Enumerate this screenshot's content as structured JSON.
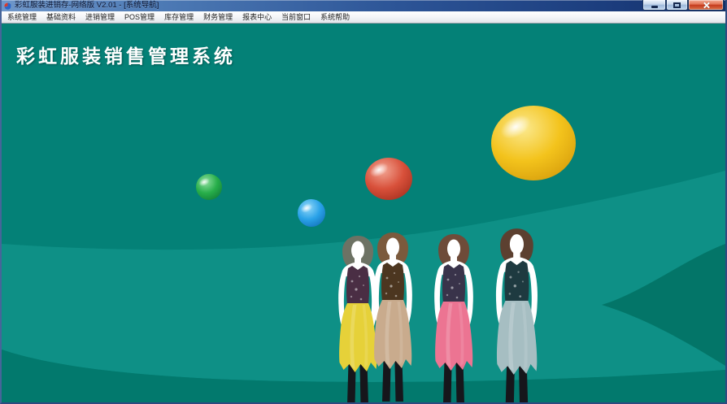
{
  "window": {
    "title": "彩虹服装进销存-网络版 V2.01 - [系统导航]"
  },
  "menubar": {
    "items": [
      {
        "label": "系统管理"
      },
      {
        "label": "基础资料"
      },
      {
        "label": "进销管理"
      },
      {
        "label": "POS管理"
      },
      {
        "label": "库存管理"
      },
      {
        "label": "财务管理"
      },
      {
        "label": "报表中心"
      },
      {
        "label": "当前窗口"
      },
      {
        "label": "系统帮助"
      }
    ]
  },
  "client": {
    "heading": "彩虹服装销售管理系统"
  },
  "colors": {
    "client_background": "#048177",
    "band_light": "#0e9086",
    "wedge_dark": "#037568",
    "bottom_dark": "#02796d",
    "titlebar_blue": "#2c5496",
    "menu_text": "#1f1f1f",
    "close_button_red": "#c43a1e",
    "heading_text": "#ffffff"
  },
  "balls": [
    {
      "name": "green-ball",
      "light": "#8fdfa0",
      "base": "#27ae4a",
      "dark": "#128038"
    },
    {
      "name": "blue-ball",
      "light": "#92d8f8",
      "base": "#2aa2e8",
      "dark": "#1374bd"
    },
    {
      "name": "red-ball",
      "light": "#f2a593",
      "base": "#d8503a",
      "dark": "#a83120"
    },
    {
      "name": "yellow-ball",
      "light": "#fbe98f",
      "base": "#f3c31c",
      "dark": "#d79e0c"
    }
  ],
  "figures": [
    {
      "name": "mannequin-yellow-dress",
      "hair": "#6d7264",
      "top_color": "#4a2e44",
      "skirt": "#e6d139",
      "skin": "#ffffff",
      "legs": "#16161b"
    },
    {
      "name": "mannequin-tan-dress",
      "hair": "#7b5a3d",
      "top_color": "#4c3620",
      "skirt": "#c9ab8d",
      "skin": "#ffffff",
      "legs": "#16161b"
    },
    {
      "name": "mannequin-pink-dress",
      "hair": "#6e4b39",
      "top_color": "#39334a",
      "skirt": "#ec7492",
      "skin": "#ffffff",
      "legs": "#16161b"
    },
    {
      "name": "mannequin-blue-dress",
      "hair": "#5c4030",
      "top_color": "#1e3a40",
      "skirt": "#a6bec2",
      "skin": "#ffffff",
      "legs": "#16161b"
    }
  ]
}
